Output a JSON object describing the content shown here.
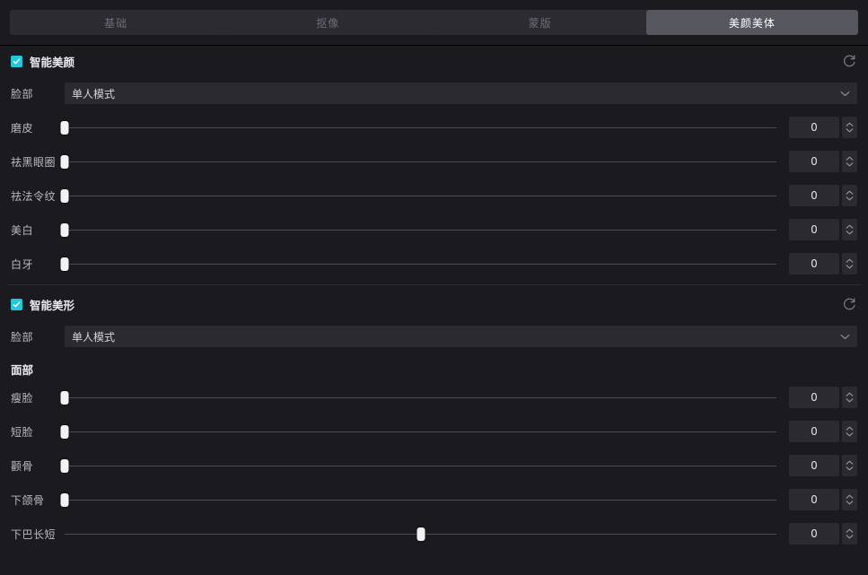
{
  "tabs": [
    {
      "label": "基础",
      "active": false
    },
    {
      "label": "抠像",
      "active": false
    },
    {
      "label": "蒙版",
      "active": false
    },
    {
      "label": "美颜美体",
      "active": true
    }
  ],
  "colors": {
    "accent": "#21c8d8",
    "panel_bg": "#1b1b1f",
    "tab_inactive": "#2b2b31",
    "tab_active": "#56565f",
    "input_bg": "#2a2a30",
    "handle": "#f2f2f4",
    "track": "#4b4b51"
  },
  "icons": {
    "reset": "reset-circular-arrow-icon",
    "chevron_down": "chevron-down-icon",
    "check": "check-icon",
    "spinner": "spinner-up-down-icon"
  },
  "sections": [
    {
      "id": "smart-beauty",
      "title": "智能美颜",
      "checked": true,
      "reset_label": "重置",
      "face": {
        "label": "脸部",
        "value": "单人模式"
      },
      "sliders": [
        {
          "label": "磨皮",
          "value": "0",
          "min": 0,
          "max": 100,
          "percent": 0
        },
        {
          "label": "祛黑眼圈",
          "value": "0",
          "min": 0,
          "max": 100,
          "percent": 0
        },
        {
          "label": "祛法令纹",
          "value": "0",
          "min": 0,
          "max": 100,
          "percent": 0
        },
        {
          "label": "美白",
          "value": "0",
          "min": 0,
          "max": 100,
          "percent": 0
        },
        {
          "label": "白牙",
          "value": "0",
          "min": 0,
          "max": 100,
          "percent": 0
        }
      ]
    },
    {
      "id": "smart-reshape",
      "title": "智能美形",
      "checked": true,
      "reset_label": "重置",
      "face": {
        "label": "脸部",
        "value": "单人模式"
      },
      "subhead": "面部",
      "sliders": [
        {
          "label": "瘦脸",
          "value": "0",
          "min": 0,
          "max": 100,
          "percent": 0
        },
        {
          "label": "短脸",
          "value": "0",
          "min": 0,
          "max": 100,
          "percent": 0
        },
        {
          "label": "颧骨",
          "value": "0",
          "min": 0,
          "max": 100,
          "percent": 0
        },
        {
          "label": "下颌骨",
          "value": "0",
          "min": 0,
          "max": 100,
          "percent": 0
        },
        {
          "label": "下巴长短",
          "value": "0",
          "min": -100,
          "max": 100,
          "percent": 50
        }
      ]
    }
  ]
}
